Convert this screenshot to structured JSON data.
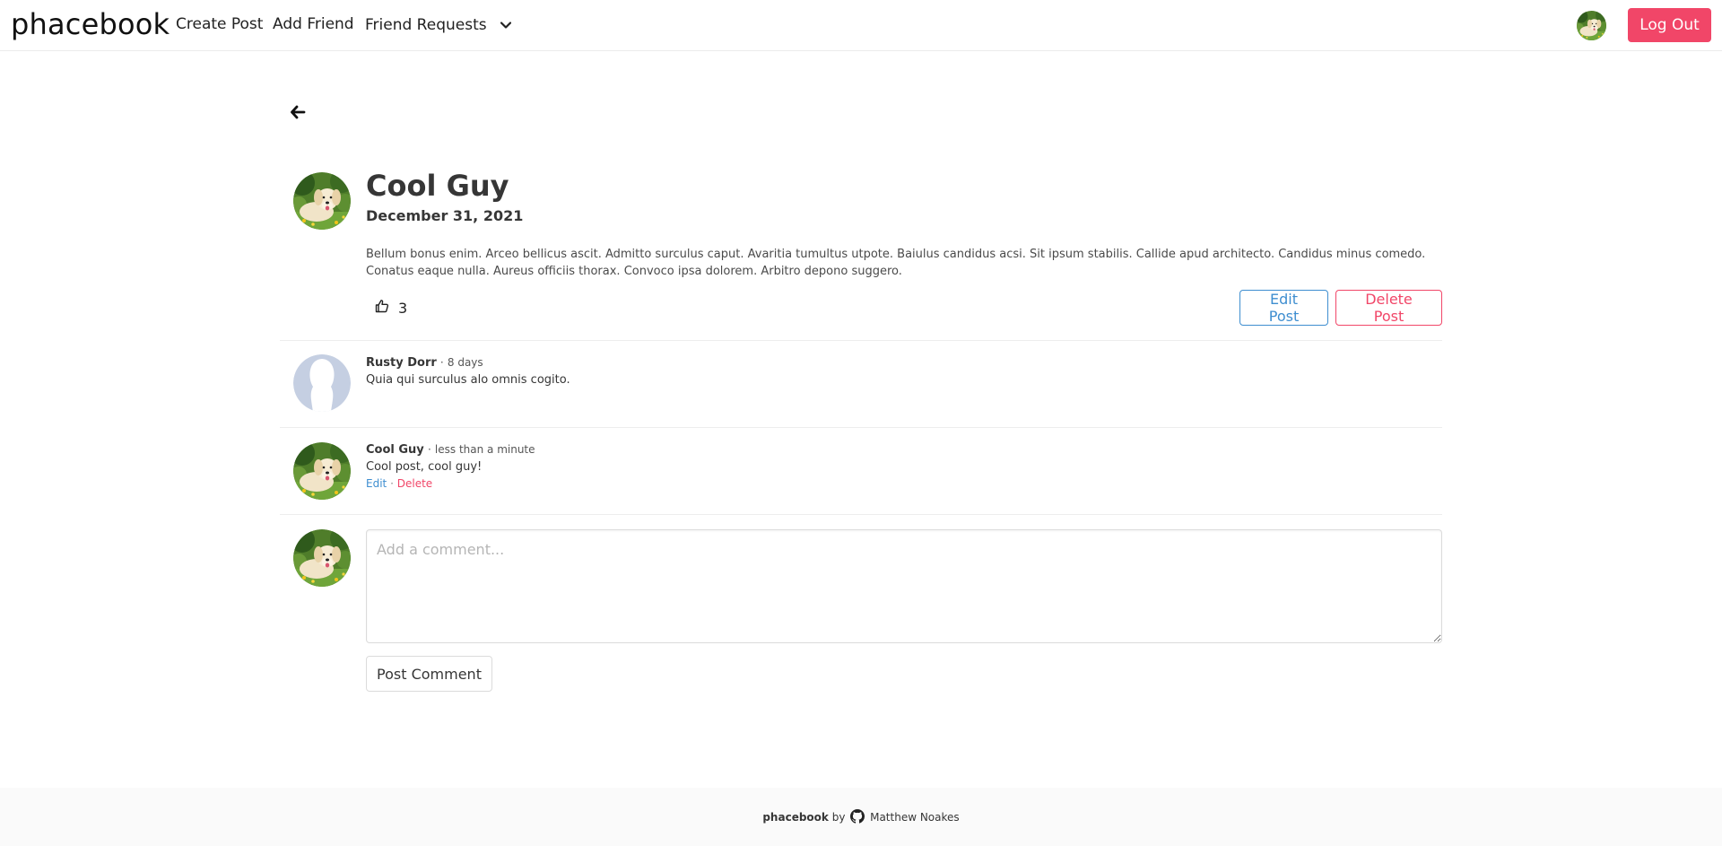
{
  "navbar": {
    "brand": "phacebook",
    "links": {
      "create_post": "Create Post",
      "add_friend": "Add Friend",
      "friend_requests": "Friend Requests"
    },
    "logout_label": "Log Out"
  },
  "post": {
    "author": "Cool Guy",
    "date": "December 31, 2021",
    "body": "Bellum bonus enim. Arceo bellicus ascit. Admitto surculus caput. Avaritia tumultus utpote. Baiulus candidus acsi. Sit ipsum stabilis. Callide apud architecto. Candidus minus comedo. Conatus eaque nulla. Aureus officiis thorax. Convoco ipsa dolorem. Arbitro depono suggero.",
    "likes": "3",
    "edit_label": "Edit Post",
    "delete_label": "Delete Post"
  },
  "comments": [
    {
      "author": "Rusty Dorr",
      "separator": "·",
      "time": "8 days",
      "text": "Quia qui surculus alo omnis cogito."
    },
    {
      "author": "Cool Guy",
      "separator": "·",
      "time": "less than a minute",
      "text": "Cool post, cool guy!",
      "edit_label": "Edit",
      "action_separator": "·",
      "delete_label": "Delete"
    }
  ],
  "comment_form": {
    "placeholder": "Add a comment...",
    "submit_label": "Post Comment"
  },
  "footer": {
    "brand": "phacebook",
    "by": "by",
    "author": "Matthew Noakes"
  },
  "icons": {
    "back": "arrow-left-icon",
    "caret": "chevron-down-icon",
    "like": "thumbs-up-icon",
    "github": "github-icon"
  },
  "colors": {
    "primary_red": "#f14668",
    "info_blue": "#3e8ed0",
    "footer_bg": "#fafafa"
  }
}
